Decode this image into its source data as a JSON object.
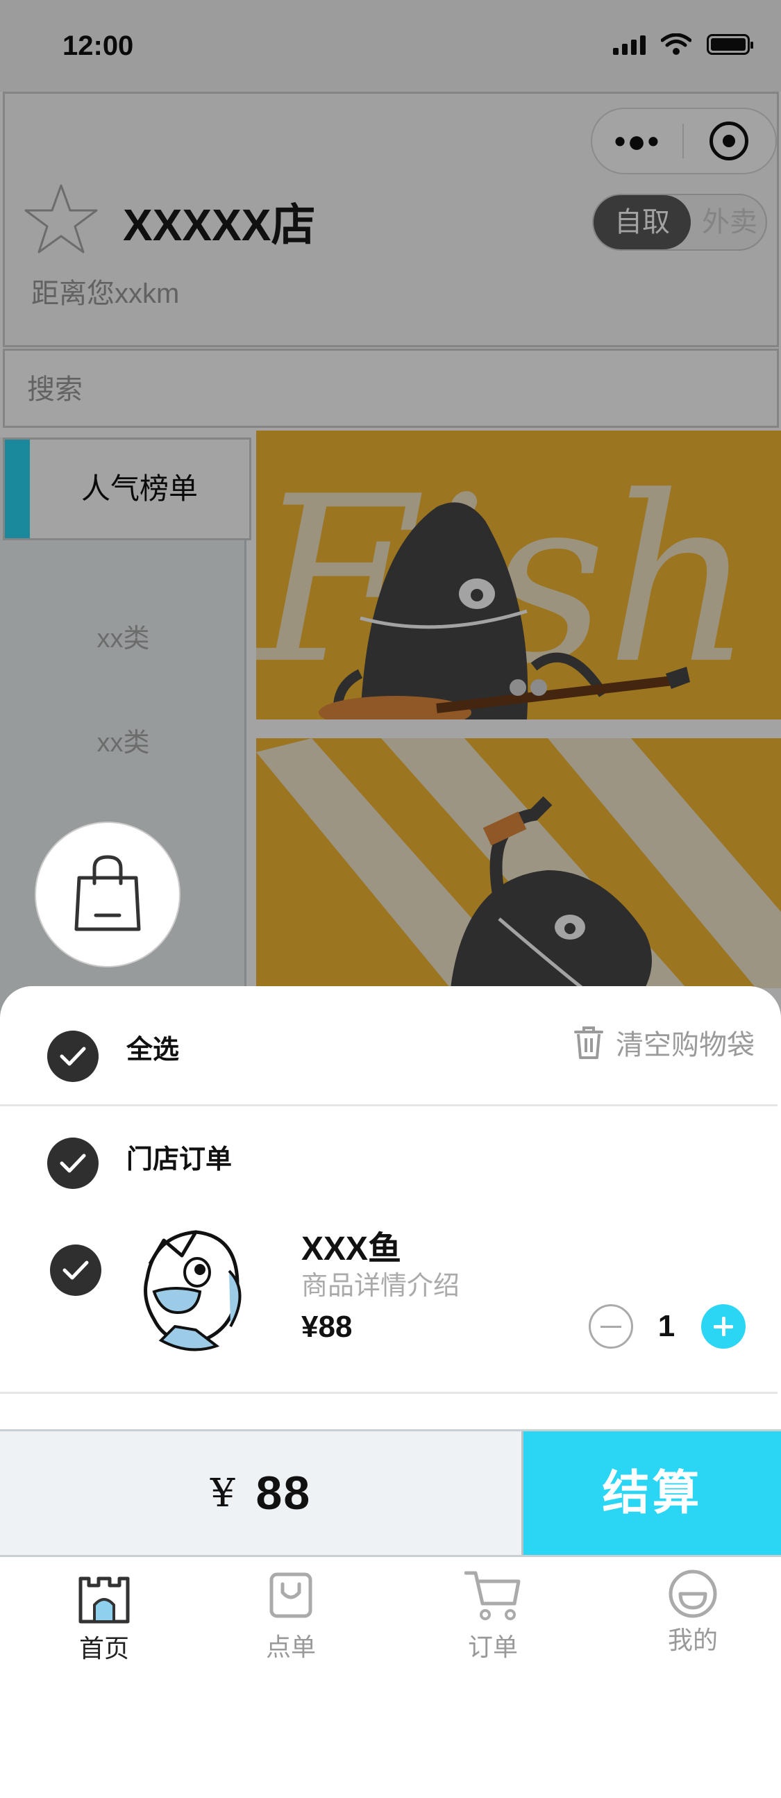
{
  "status_bar": {
    "time": "12:00"
  },
  "header": {
    "store_name": "XXXXX店",
    "distance": "距离您xxkm",
    "mode_pickup": "自取",
    "mode_delivery": "外卖"
  },
  "search": {
    "placeholder": "搜索"
  },
  "categories": {
    "active": "人气榜单",
    "items": [
      "xx类",
      "xx类"
    ]
  },
  "cart": {
    "select_all_label": "全选",
    "clear_label": "清空购物袋",
    "store_order_label": "门店订单",
    "item": {
      "name": "XXX鱼",
      "description": "商品详情介绍",
      "price": "¥88",
      "quantity": "1"
    }
  },
  "checkout": {
    "currency": "¥",
    "total": "88",
    "button_label": "结算"
  },
  "tabs": [
    {
      "label": "首页",
      "icon": "castle-icon"
    },
    {
      "label": "点单",
      "icon": "shopping-bag-icon"
    },
    {
      "label": "订单",
      "icon": "cart-icon"
    },
    {
      "label": "我的",
      "icon": "smiley-icon"
    }
  ],
  "colors": {
    "accent": "#2bd6f5",
    "dark": "#2f2f2f"
  }
}
